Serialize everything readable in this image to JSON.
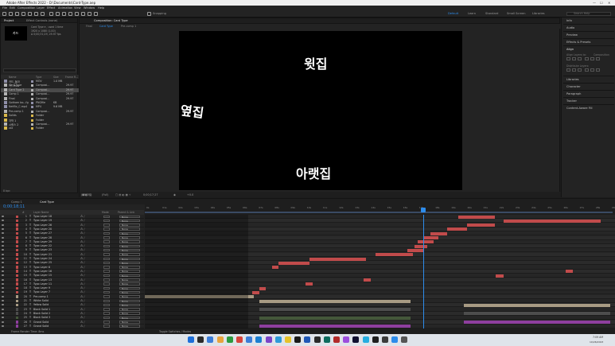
{
  "window": {
    "title": "Adobe After Effects 2022 - D:\\Documents\\Card-Type.aep",
    "controls": [
      "—",
      "☐",
      "✕"
    ]
  },
  "menu": [
    "File",
    "Edit",
    "Composition",
    "Layer",
    "Effect",
    "Animation",
    "View",
    "Window",
    "Help"
  ],
  "toolbar": {
    "snapping": "Snapping",
    "workspaces": [
      "Default",
      "Learn",
      "Standard",
      "Small Screen",
      "Libraries"
    ],
    "active_workspace": "Default",
    "search_placeholder": "Search Help"
  },
  "project": {
    "tabs": [
      "Project",
      "Effect Controls (none)"
    ],
    "thumb_text": "카드",
    "info": [
      "Card Type ▾ , used 1 time",
      "1920 x 1080 (1.00)",
      "Δ 0;00;31;29, 29.97 fps"
    ],
    "search_placeholder": "",
    "columns": [
      "Name",
      "Type",
      "Size",
      "Frame R..."
    ],
    "items": [
      {
        "name": "카드_돌아가...mov",
        "type": "MOV",
        "size": "1.0 MB",
        "rate": "",
        "color": "#8f8fa8",
        "selected": false
      },
      {
        "name": "Card Type",
        "type": "Composi...",
        "size": "",
        "rate": "29.97",
        "color": "#b4b4b4",
        "selected": false
      },
      {
        "name": "Card Type 2",
        "type": "Composi...",
        "size": "",
        "rate": "29.97",
        "color": "#b4b4b4",
        "selected": true
      },
      {
        "name": "Comp 1",
        "type": "Composi...",
        "size": "",
        "rate": "29.97",
        "color": "#b4b4b4",
        "selected": false
      },
      {
        "name": "Final",
        "type": "Composi...",
        "size": "",
        "rate": "29.97",
        "color": "#b4b4b4",
        "selected": false
      },
      {
        "name": "Gotham bo...fg",
        "type": "PNGfile",
        "size": "KB",
        "rate": "",
        "color": "#8f8fa8",
        "selected": false
      },
      {
        "name": "Netflix_C.mp4",
        "type": "MP4",
        "size": "9.6 MB",
        "rate": "",
        "color": "#8f8fa8",
        "selected": false
      },
      {
        "name": "Pre-comp 1",
        "type": "Composi...",
        "size": "",
        "rate": "29.97",
        "color": "#b4b4b4",
        "selected": false
      },
      {
        "name": "Solids",
        "type": "Folder",
        "size": "",
        "rate": "",
        "color": "#d9b84a",
        "selected": false
      },
      {
        "name": "자막 1",
        "type": "Folder",
        "size": "",
        "rate": "",
        "color": "#d9b84a",
        "selected": false
      },
      {
        "name": "시퀀스 2",
        "type": "Composi...",
        "size": "",
        "rate": "29.97",
        "color": "#b4b4b4",
        "selected": false
      },
      {
        "name": "zzz",
        "type": "Folder",
        "size": "",
        "rate": "",
        "color": "#d9b84a",
        "selected": false
      }
    ],
    "footer": "8 bpc"
  },
  "viewer": {
    "tab": "Composition: Card Type",
    "sub_tabs": [
      "Final",
      "Card Type",
      "Pre-comp 1"
    ],
    "active_sub": "Card Type",
    "canvas_texts": [
      "윗집",
      "옆집",
      "아랫집"
    ],
    "footer": [
      "(66.4%)",
      "(Full)",
      "0;00;17;27",
      "+0.0"
    ]
  },
  "right_panel": {
    "items": [
      "Info",
      "Audio",
      "Preview",
      "Effects & Presets",
      "Align",
      "Libraries",
      "Character",
      "Paragraph",
      "Tracker",
      "Content-Aware Fill"
    ],
    "align_sub": [
      "Align Layers to:",
      "Distribute Layers:"
    ],
    "align_target": "Composition"
  },
  "timeline": {
    "tabs": [
      "Comp 1",
      "Card Type"
    ],
    "active_tab": "Card Type",
    "timecode": "0;00;18;11",
    "columns": [
      "#",
      "Layer Name",
      "Mode",
      "Parent & Link"
    ],
    "ruler_ticks": [
      "0s",
      "01s",
      "02s",
      "03s",
      "04s",
      "05s",
      "06s",
      "07s",
      "08s",
      "09s",
      "10s",
      "11s",
      "12s",
      "13s",
      "14s",
      "15s",
      "16s",
      "17s",
      "18s",
      "19s",
      "20s",
      "21s",
      "22s",
      "23s",
      "24s",
      "25s",
      "26s",
      "27s",
      "28s",
      "29s"
    ],
    "layers": [
      {
        "n": "1",
        "name": "Typo Layer 18",
        "parent": "None",
        "color": "#c14b4b",
        "bar": [
          0.667,
          0.744
        ]
      },
      {
        "n": "2",
        "name": "Typo Layer 19",
        "parent": "None",
        "color": "#c14b4b",
        "bar": [
          0.763,
          0.97
        ]
      },
      {
        "n": "3",
        "name": "Typo Layer 26",
        "parent": "None",
        "color": "#c14b4b",
        "bar": [
          0.686,
          0.744
        ]
      },
      {
        "n": "4",
        "name": "Typo Layer 20",
        "parent": "None",
        "color": "#c14b4b",
        "bar": [
          0.643,
          0.686
        ]
      },
      {
        "n": "5",
        "name": "Typo Layer 27",
        "parent": "None",
        "color": "#c14b4b",
        "bar": [
          0.608,
          0.643
        ]
      },
      {
        "n": "6",
        "name": "Typo Layer 28",
        "parent": "None",
        "color": "#c14b4b",
        "bar": [
          0.592,
          0.625
        ]
      },
      {
        "n": "7",
        "name": "Typo Layer 29",
        "parent": "None",
        "color": "#c14b4b",
        "bar": [
          0.58,
          0.615
        ]
      },
      {
        "n": "8",
        "name": "Typo Layer 22",
        "parent": "None",
        "color": "#c14b4b",
        "bar": [
          0.573,
          0.6
        ]
      },
      {
        "n": "9",
        "name": "Typo Layer 23",
        "parent": "None",
        "color": "#c14b4b",
        "bar": [
          0.559,
          0.592
        ]
      },
      {
        "n": "10",
        "name": "Typo Layer 21",
        "parent": "None",
        "color": "#c14b4b",
        "bar": [
          0.49,
          0.57
        ]
      },
      {
        "n": "11",
        "name": "Typo Layer 24",
        "parent": "None",
        "color": "#c14b4b",
        "bar": [
          0.35,
          0.47
        ]
      },
      {
        "n": "12",
        "name": "Typo Layer 25",
        "parent": "None",
        "color": "#c14b4b",
        "bar": [
          0.285,
          0.35
        ]
      },
      {
        "n": "13",
        "name": "Typo Layer 6",
        "parent": "None",
        "color": "#c14b4b",
        "bar": [
          0.27,
          0.285
        ]
      },
      {
        "n": "14",
        "name": "Typo Layer 16",
        "parent": "None",
        "color": "#c14b4b",
        "bar": [
          0.895,
          0.91
        ]
      },
      {
        "n": "15",
        "name": "Typo Layer 15",
        "parent": "None",
        "color": "#c14b4b",
        "bar": [
          0.746,
          0.763
        ]
      },
      {
        "n": "16",
        "name": "Typo Layer 13",
        "parent": "None",
        "color": "#c14b4b",
        "bar": [
          0.465,
          0.48
        ]
      },
      {
        "n": "17",
        "name": "Typo Layer 11",
        "parent": "None",
        "color": "#c14b4b",
        "bar": [
          0.342,
          0.357
        ]
      },
      {
        "n": "18",
        "name": "Typo Layer 9",
        "parent": "None",
        "color": "#c14b4b",
        "bar": [
          0.243,
          0.258
        ]
      },
      {
        "n": "19",
        "name": "Typo Layer 7",
        "parent": "None",
        "color": "#c14b4b",
        "bar": [
          0.228,
          0.243
        ]
      },
      {
        "n": "20",
        "name": "Pre-comp 1",
        "parent": "None",
        "color": "#a89b84",
        "bar": [
          0.0,
          0.232
        ]
      },
      {
        "n": "21",
        "name": "White Solid",
        "parent": "None",
        "color": "#a89b84",
        "bar": [
          0.243,
          0.565
        ]
      },
      {
        "n": "22",
        "name": "Yellow Solid",
        "parent": "None",
        "color": "#a89b84",
        "bar": [
          0.678,
          0.99
        ]
      },
      {
        "n": "23",
        "name": "Black Solid 1",
        "parent": "None",
        "color": "#4d4d4d",
        "bar": [
          0.243,
          0.565
        ]
      },
      {
        "n": "24",
        "name": "Black Solid 2",
        "parent": "None",
        "color": "#4d4d4d",
        "bar": [
          0.678,
          0.99
        ]
      },
      {
        "n": "25",
        "name": "Black Solid 3",
        "parent": "None",
        "color": "#44573a",
        "bar": [
          0.243,
          0.565
        ]
      },
      {
        "n": "26",
        "name": "Grand Solid",
        "parent": "None",
        "color": "#8e3f9e",
        "bar": [
          0.678,
          0.99
        ]
      },
      {
        "n": "27",
        "name": "Grand Solid",
        "parent": "None",
        "color": "#8e3f9e",
        "bar": [
          0.243,
          0.565
        ]
      }
    ],
    "playhead_fraction": 0.592,
    "footer": [
      "Frame Render Time: 8ms",
      "Toggle Switches / Modes"
    ]
  },
  "taskbar": {
    "time": "7:09 AM",
    "date": "10/26/2023"
  },
  "colors": {
    "accent": "#2d8ceb",
    "panel": "#232323",
    "typo_bar": "#c14b4b"
  }
}
